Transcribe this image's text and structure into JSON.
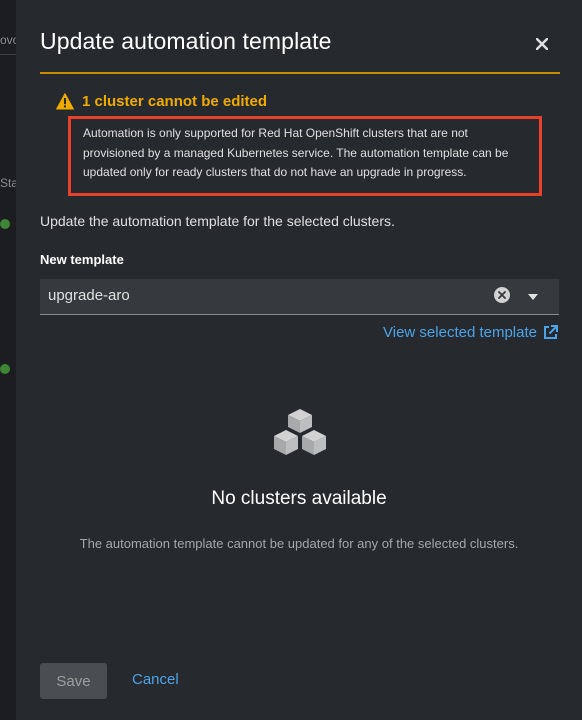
{
  "background": {
    "fragments": [
      "ovo",
      "Sta"
    ]
  },
  "modal": {
    "title": "Update automation template",
    "close_icon": "close-icon"
  },
  "alert": {
    "variant": "warning",
    "icon": "warning-triangle-icon",
    "title": "1 cluster cannot be edited",
    "description": "Automation is only supported for Red Hat OpenShift clusters that are not provisioned by a managed Kubernetes service. The automation template can be updated only for ready clusters that do not have an upgrade in progress."
  },
  "intro": "Update the automation template for the selected clusters.",
  "template_field": {
    "label": "New template",
    "value": "upgrade-aro",
    "clear_icon": "clear-icon",
    "toggle_icon": "caret-down-icon"
  },
  "view_link": {
    "label": "View selected template",
    "icon": "external-link-icon"
  },
  "empty_state": {
    "icon": "cubes-icon",
    "title": "No clusters available",
    "body": "The automation template cannot be updated for any of the selected clusters."
  },
  "footer": {
    "save_label": "Save",
    "cancel_label": "Cancel"
  },
  "colors": {
    "accent": "#c58c00",
    "warning": "#f0ab00",
    "link": "#4da3e8",
    "highlight_box": "#e8412b"
  }
}
